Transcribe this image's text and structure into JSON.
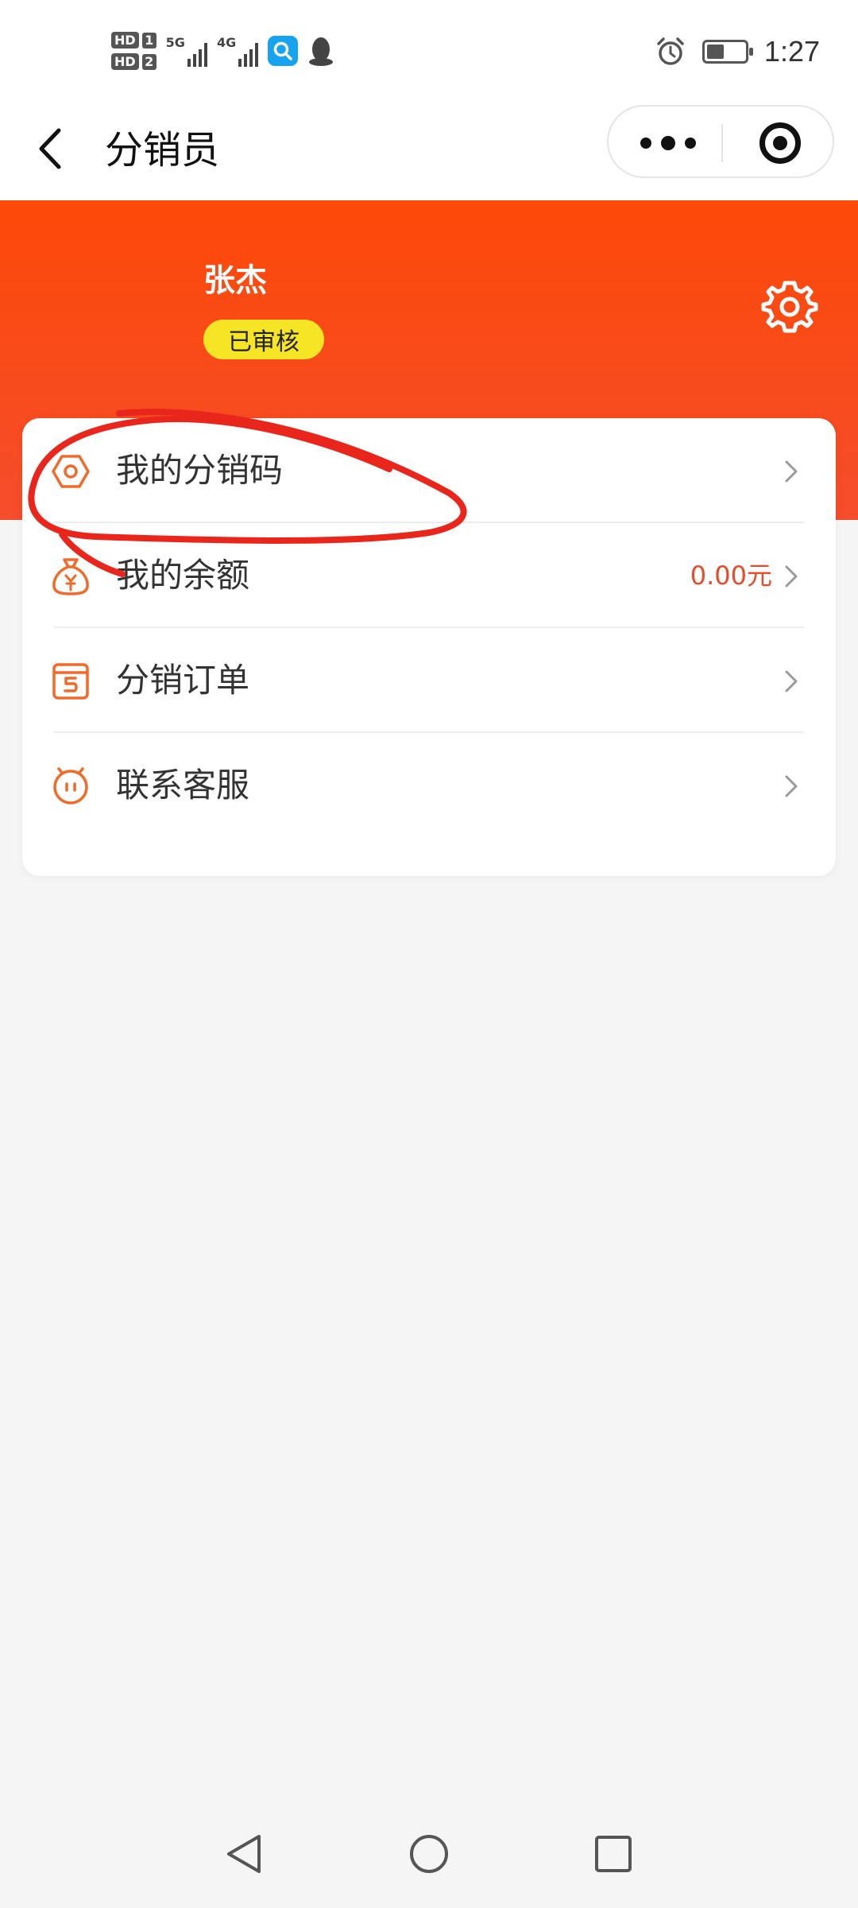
{
  "status_bar": {
    "hd1": "HD",
    "hd1_num": "1",
    "hd2": "HD",
    "hd2_num": "2",
    "net1": "5G",
    "net2": "4G",
    "time": "1:27",
    "battery_level": 0.4
  },
  "nav": {
    "title": "分销员"
  },
  "header": {
    "user_name": "张杰",
    "status": "已审核"
  },
  "menu": {
    "items": [
      {
        "label": "我的分销码",
        "value": "",
        "icon": "hexagon-code-icon"
      },
      {
        "label": "我的余额",
        "value": "0.00元",
        "icon": "money-bag-icon"
      },
      {
        "label": "分销订单",
        "value": "",
        "icon": "order-box-icon"
      },
      {
        "label": "联系客服",
        "value": "",
        "icon": "service-face-icon"
      }
    ]
  },
  "colors": {
    "brand": "#fd4a08",
    "badge": "#f6e525",
    "accent": "#e84b2c",
    "annotation": "#e8261c"
  }
}
